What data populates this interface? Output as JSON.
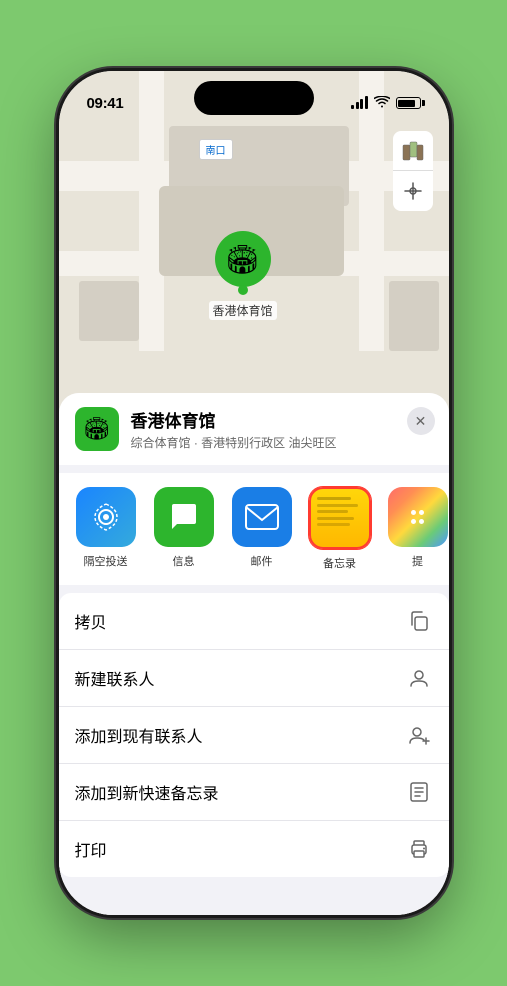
{
  "status_bar": {
    "time": "09:41",
    "location_arrow": "▶"
  },
  "map": {
    "label": "南口",
    "controls": {
      "map_type": "🗺",
      "location": "➤"
    }
  },
  "venue": {
    "name": "香港体育馆",
    "subtitle": "综合体育馆 · 香港特别行政区 油尖旺区",
    "icon": "🏟"
  },
  "close_button_label": "✕",
  "share_items": [
    {
      "id": "airdrop",
      "label": "隔空投送",
      "icon_type": "airdrop"
    },
    {
      "id": "messages",
      "label": "信息",
      "icon_type": "messages"
    },
    {
      "id": "mail",
      "label": "邮件",
      "icon_type": "mail"
    },
    {
      "id": "notes",
      "label": "备忘录",
      "icon_type": "notes",
      "selected": true
    },
    {
      "id": "more",
      "label": "提",
      "icon_type": "more"
    }
  ],
  "actions": [
    {
      "id": "copy",
      "label": "拷贝",
      "icon": "copy"
    },
    {
      "id": "new-contact",
      "label": "新建联系人",
      "icon": "person"
    },
    {
      "id": "add-existing",
      "label": "添加到现有联系人",
      "icon": "person-plus"
    },
    {
      "id": "add-notes",
      "label": "添加到新快速备忘录",
      "icon": "note"
    },
    {
      "id": "print",
      "label": "打印",
      "icon": "printer"
    }
  ],
  "pin": {
    "label": "香港体育馆",
    "emoji": "🏟"
  }
}
